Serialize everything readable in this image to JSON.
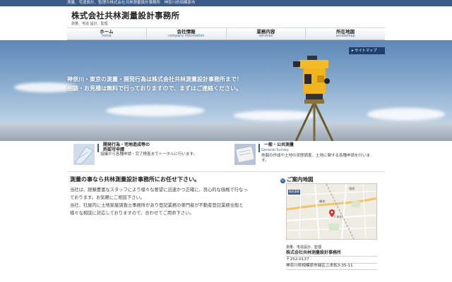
{
  "topbar": {
    "text": "測量、宅造設計、監理の株式会社共林測量設計事務所　神奈川県相模原市"
  },
  "header": {
    "company_name": "株式会社共林測量設計事務所",
    "subtitle": "測量、宅造 設計、監理"
  },
  "nav": [
    {
      "label": "ホーム",
      "sub": "home"
    },
    {
      "label": "会社情報",
      "sub": "company information"
    },
    {
      "label": "業務内容",
      "sub": "services"
    },
    {
      "label": "所在地図",
      "sub": "accessmap"
    }
  ],
  "hero": {
    "sitemap_label": "サイトマップ",
    "sitemap_icon": "arrow-right-icon",
    "line1": "神奈川・東京の測量・開発行為は株式会社共林測量設計事務所まで！",
    "line2": "相談・お見積は無料で行っておりますので、まずはご連絡ください。"
  },
  "features": [
    {
      "title_line1": "開発行為・宅地造成等の",
      "title_line2": "許認可申請",
      "desc": "協議から各種申請・完了検査までトータルに行います。"
    },
    {
      "title_line1": "一般・公共測量",
      "en": "General Survey",
      "desc_line1": "地図の作成や土地の状態調査、土地に関する各種申請を行いま",
      "desc_line2": "す。"
    }
  ],
  "main": {
    "heading": "測量の事なら共林測量設計事務所にお任せ下さい。",
    "p1_line1": "当社は、経験豊富なスタッフにより様々な要望に迅速かつ正確に、良心的な価格で行なっ",
    "p1_line2": "ております。お気軽にご相談下さい。",
    "p2_line1": "当社、社屋内に土地家屋調査士事務所があり登記業務の専門者が不動産登記業務全般と",
    "p2_line2": "様々な相談に対応しておりますので、合わせてご用命下さい。"
  },
  "sidebar": {
    "title": "ご案内地図",
    "map_labels": {
      "legend": "福良島駅",
      "area1": "相原",
      "area2": "橋本",
      "area3": "二本松"
    },
    "info_line1": "測量、宅造設計、監理",
    "company": "株式会社共林測量設計事務所",
    "postal": "〒252-0137",
    "address": "神奈川県相模原市緑区二本松3-35-11"
  },
  "colors": {
    "topbar": "#3b5a86",
    "accent": "#2d5a96",
    "nav_sub": "#3c6fb0",
    "sitemap_bg": "#1f3f6e"
  }
}
